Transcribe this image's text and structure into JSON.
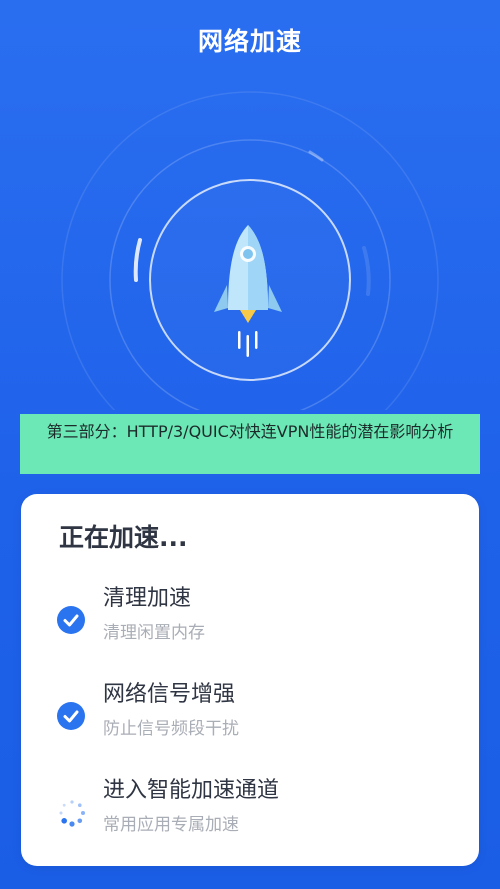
{
  "header": {
    "title": "网络加速"
  },
  "banner": {
    "text": "第三部分：HTTP/3/QUIC对快连VPN性能的潜在影响分析"
  },
  "card": {
    "title": "正在加速...",
    "steps": [
      {
        "title": "清理加速",
        "subtitle": "清理闲置内存",
        "status": "done",
        "icon": "check-circle-icon"
      },
      {
        "title": "网络信号增强",
        "subtitle": "防止信号频段干扰",
        "status": "done",
        "icon": "check-circle-icon"
      },
      {
        "title": "进入智能加速通道",
        "subtitle": "常用应用专属加速",
        "status": "loading",
        "icon": "loading-spinner-icon"
      }
    ]
  },
  "colors": {
    "background": "#1f62ea",
    "banner": "#6ce7b6",
    "accent": "#2a74f0",
    "rocket": "#a9ddf8"
  }
}
